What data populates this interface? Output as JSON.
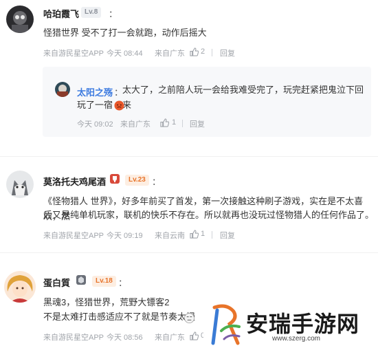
{
  "comments": [
    {
      "author": "哈珀霞飞",
      "level": "Lv.8",
      "colon": "：",
      "text": "怪猎世界 受不了打一会就跑，动作后摇大",
      "source": "来自游民星空APP",
      "time": "今天 08:44",
      "location": "来自广东",
      "likes": "2",
      "reply_label": "回复",
      "reply": {
        "author": "太阳之殇",
        "colon": "：",
        "text_line1": "太大了，之前陪人玩一会给我难受完了，玩完赶紧把鬼泣下回来",
        "text_line2": "玩了一宿",
        "time": "今天 09:02",
        "location": "来自广东",
        "likes": "1",
        "reply_label": "回复"
      }
    },
    {
      "author": "莫洛托夫鸡尾酒",
      "level": "Lv.23",
      "colon": "：",
      "text_line1": "《怪物猎人 世界》，好多年前买了首发，第一次接触这种刷子游戏，实在是不太喜欢，然",
      "text_line2": "后又是纯单机玩家，联机的快乐不存在。所以就再也没玩过怪物猎人的任何作品了。",
      "source": "来自游民星空APP",
      "time": "今天 09:19",
      "location": "来自云南",
      "likes": "1",
      "reply_label": "回复"
    },
    {
      "author": "蛋白質",
      "level": "Lv.18",
      "colon": "：",
      "text_line1": "黑魂3，怪猎世界，荒野大镖客2",
      "text_line2": "不是太难打击感适应不了就是节奏太慢",
      "source": "来自游民星空APP",
      "time": "今天 08:56",
      "location": "来自广东",
      "likes": "0"
    }
  ],
  "watermark": {
    "title": "安瑞手游网",
    "url": "www.szerg.com"
  },
  "colors": {
    "reply_author": "#3d7be0",
    "level_orange": "#e8742a",
    "meta_gray": "#a0a4aa",
    "reply_bg": "#f7f8fa"
  }
}
